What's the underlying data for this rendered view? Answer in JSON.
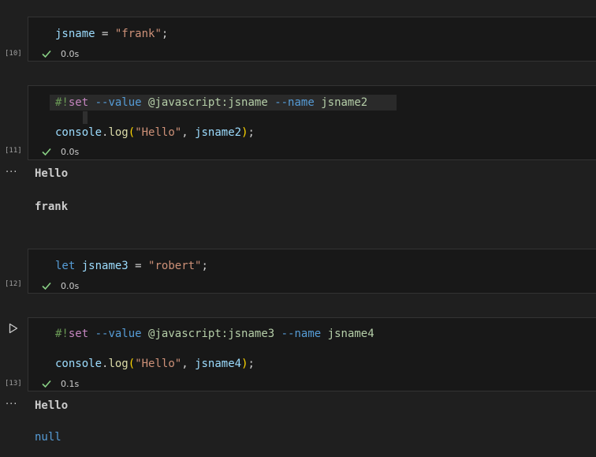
{
  "cells": [
    {
      "exec": "[10]",
      "time": "0.0s",
      "lines": [
        [
          {
            "t": "jsname",
            "c": "var"
          },
          {
            "t": " = ",
            "c": "plain"
          },
          {
            "t": "\"frank\"",
            "c": "str"
          },
          {
            "t": ";",
            "c": "plain"
          }
        ]
      ]
    },
    {
      "exec": "[11]",
      "time": "0.0s",
      "lines": [
        [
          {
            "t": "#!",
            "c": "green"
          },
          {
            "t": "set",
            "c": "kw-pink"
          },
          {
            "t": " ",
            "c": "plain"
          },
          {
            "t": "--value",
            "c": "flag"
          },
          {
            "t": " ",
            "c": "plain"
          },
          {
            "t": "@javascript:jsname",
            "c": "light-green"
          },
          {
            "t": " ",
            "c": "plain"
          },
          {
            "t": "--name",
            "c": "flag"
          },
          {
            "t": " ",
            "c": "plain"
          },
          {
            "t": "jsname2",
            "c": "light-green"
          }
        ],
        [
          {
            "t": "console",
            "c": "var"
          },
          {
            "t": ".",
            "c": "plain"
          },
          {
            "t": "log",
            "c": "fn"
          },
          {
            "t": "(",
            "c": "paren"
          },
          {
            "t": "\"Hello\"",
            "c": "str"
          },
          {
            "t": ", ",
            "c": "plain"
          },
          {
            "t": "jsname2",
            "c": "var"
          },
          {
            "t": ")",
            "c": "paren"
          },
          {
            "t": ";",
            "c": "plain"
          }
        ]
      ],
      "outputs": [
        "Hello",
        "frank"
      ]
    },
    {
      "exec": "[12]",
      "time": "0.0s",
      "lines": [
        [
          {
            "t": "let",
            "c": "kw-blue"
          },
          {
            "t": " ",
            "c": "plain"
          },
          {
            "t": "jsname3",
            "c": "var"
          },
          {
            "t": " = ",
            "c": "plain"
          },
          {
            "t": "\"robert\"",
            "c": "str"
          },
          {
            "t": ";",
            "c": "plain"
          }
        ]
      ]
    },
    {
      "exec": "[13]",
      "time": "0.1s",
      "lines": [
        [
          {
            "t": "#!",
            "c": "green"
          },
          {
            "t": "set",
            "c": "kw-pink"
          },
          {
            "t": " ",
            "c": "plain"
          },
          {
            "t": "--value",
            "c": "flag"
          },
          {
            "t": " ",
            "c": "plain"
          },
          {
            "t": "@javascript:jsname3",
            "c": "light-green"
          },
          {
            "t": " ",
            "c": "plain"
          },
          {
            "t": "--name",
            "c": "flag"
          },
          {
            "t": " ",
            "c": "plain"
          },
          {
            "t": "jsname4",
            "c": "light-green"
          }
        ],
        [
          {
            "t": "console",
            "c": "var"
          },
          {
            "t": ".",
            "c": "plain"
          },
          {
            "t": "log",
            "c": "fn"
          },
          {
            "t": "(",
            "c": "paren"
          },
          {
            "t": "\"Hello\"",
            "c": "str"
          },
          {
            "t": ", ",
            "c": "plain"
          },
          {
            "t": "jsname4",
            "c": "var"
          },
          {
            "t": ")",
            "c": "paren"
          },
          {
            "t": ";",
            "c": "plain"
          }
        ]
      ],
      "outputs": [
        "Hello",
        "null"
      ]
    }
  ],
  "output_menu": "···",
  "icons": {
    "status": "check-icon",
    "run": "play-icon",
    "check_color": "#89d185"
  }
}
